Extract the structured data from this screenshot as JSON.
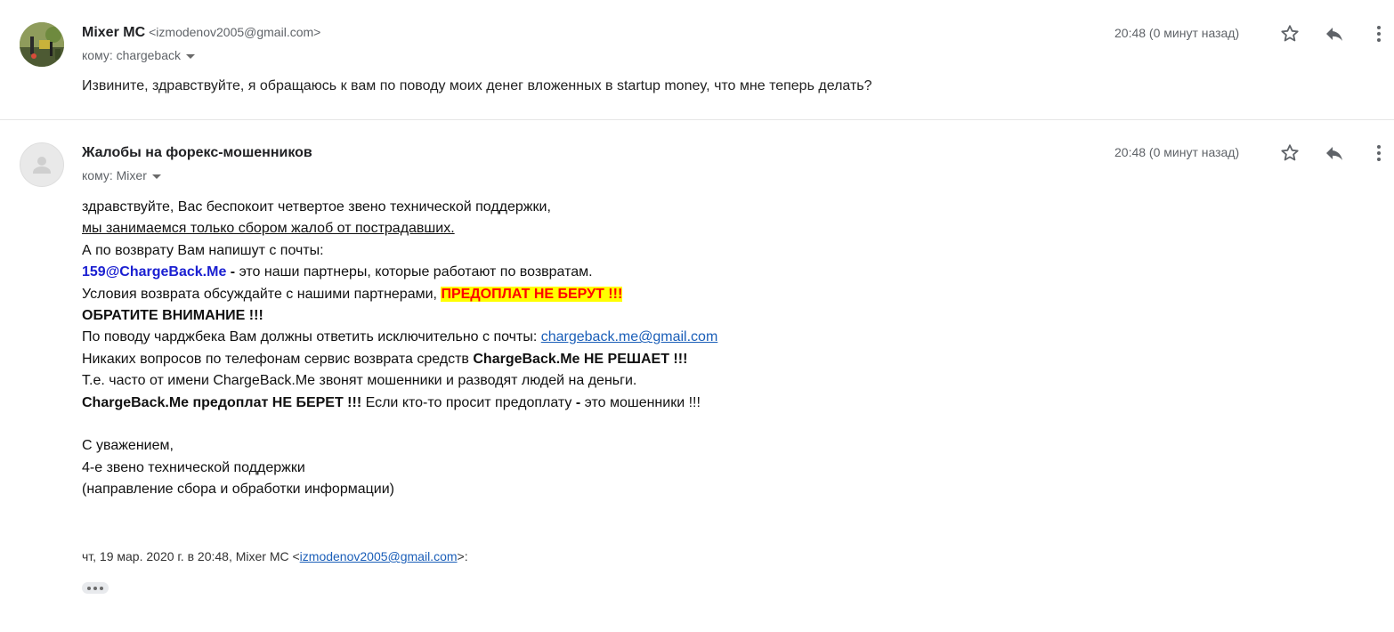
{
  "messages": [
    {
      "sender_name": "Mixer MC",
      "sender_email": "<izmodenov2005@gmail.com>",
      "to_label": "кому: chargeback",
      "time": "20:48 (0 минут назад)",
      "body": "Извините, здравствуйте, я обращаюсь к вам по поводу моих денег вложенных в startup money, что мне теперь делать?"
    },
    {
      "sender_name": "Жалобы на форекс-мошенников",
      "to_label": "кому: Mixer",
      "time": "20:48 (0 минут назад)",
      "body": {
        "l1": "здравствуйте, Вас беспокоит четвертое звено технической поддержки,",
        "l2": "мы занимаемся только сбором жалоб от пострадавших.",
        "l3": "А по возврату Вам напишут с почты:",
        "l4_email": "159@ChargeBack.Me",
        "l4_dash": " - ",
        "l4_text": "это наши партнеры, которые работают по возвратам.",
        "l5_text": "Условия возврата обсуждайте с нашими партнерами, ",
        "l5_highlight": "ПРЕДОПЛАТ НЕ БЕРУТ !!!",
        "l6": "ОБРАТИТЕ ВНИМАНИЕ !!!",
        "l7_text": "По поводу чарджбека Вам должны ответить исключительно с почты: ",
        "l7_link": "chargeback.me@gmail.com",
        "l8_text": "Никаких вопросов по телефонам сервис возврата средств ",
        "l8_bold": "ChargeBack.Me НЕ РЕШАЕТ !!!",
        "l9": "Т.е. часто от имени ChargeBack.Me звонят мошенники и разводят людей на деньги.",
        "l10_bold": "ChargeBack.Me предоплат НЕ БЕРЕТ !!!",
        "l10_text": " Если кто-то просит предоплату ",
        "l10_dash": "-",
        "l10_text2": " это мошенники !!!",
        "sign1": "С уважением,",
        "sign2": "4-е звено технической поддержки",
        "sign3": "(направление сбора и обработки информации)"
      },
      "quote_prefix": "чт, 19 мар. 2020 г. в 20:48, Mixer MC <",
      "quote_link": "izmodenov2005@gmail.com",
      "quote_suffix": ">:"
    }
  ],
  "icons": {
    "star": "star-icon",
    "reply": "reply-icon",
    "more": "more-vert-icon",
    "avatar_default": "person-icon"
  },
  "colors": {
    "link": "#1a5eb8",
    "email_bold": "#1a1fd1",
    "highlight_bg": "#ffff00",
    "highlight_text": "#ff0000"
  }
}
